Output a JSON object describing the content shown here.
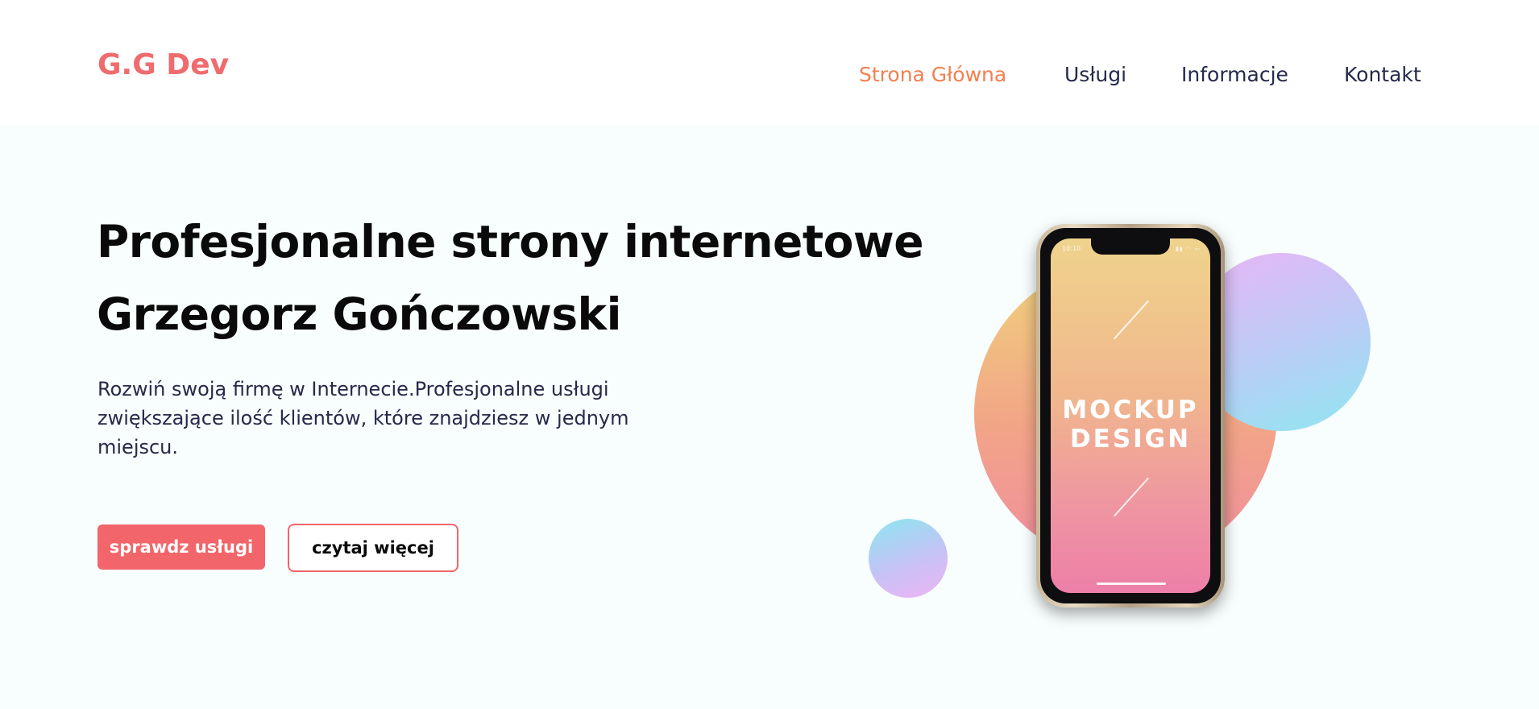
{
  "header": {
    "logo": "G.G Dev",
    "nav": [
      {
        "label": "Strona Główna",
        "active": true
      },
      {
        "label": "Usługi",
        "active": false
      },
      {
        "label": "Informacje",
        "active": false
      },
      {
        "label": "Kontakt",
        "active": false
      }
    ]
  },
  "hero": {
    "title_line1": "Profesjonalne strony internetowe",
    "title_line2": "Grzegorz Gończowski",
    "description": "Rozwiń swoją firmę w Internecie.Profesjonalne usługi zwiększające ilość klientów, które znajdziesz w jednym miejscu.",
    "primary_button": "sprawdz usługi",
    "secondary_button": "czytaj więcej"
  },
  "mockup": {
    "status_time": "10:10",
    "line1": "MOCKUP",
    "line2": "DESIGN"
  },
  "colors": {
    "accent": "#f2656a",
    "nav_active": "#f47f4e",
    "text_dark": "#262a4a",
    "background": "#f8fdfd"
  }
}
